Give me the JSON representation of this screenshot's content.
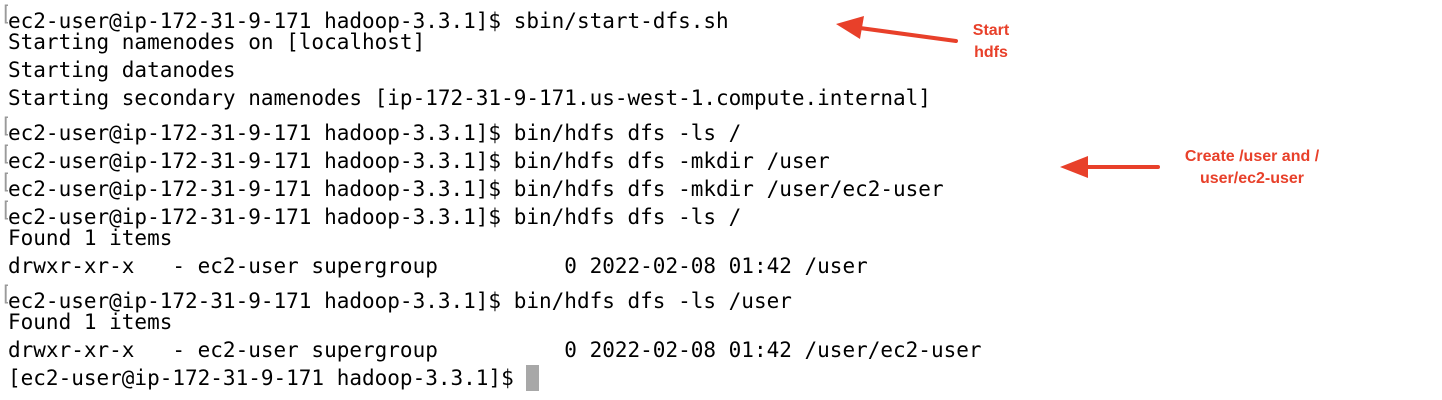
{
  "terminal": {
    "lines": [
      {
        "prefix": "[",
        "text": "ec2-user@ip-172-31-9-171 hadoop-3.3.1]$ sbin/start-dfs.sh"
      },
      {
        "prefix": "",
        "text": "Starting namenodes on [localhost]"
      },
      {
        "prefix": "",
        "text": "Starting datanodes"
      },
      {
        "prefix": "",
        "text": "Starting secondary namenodes [ip-172-31-9-171.us-west-1.compute.internal]"
      },
      {
        "prefix": "[",
        "text": "ec2-user@ip-172-31-9-171 hadoop-3.3.1]$ bin/hdfs dfs -ls /"
      },
      {
        "prefix": "[",
        "text": "ec2-user@ip-172-31-9-171 hadoop-3.3.1]$ bin/hdfs dfs -mkdir /user"
      },
      {
        "prefix": "[",
        "text": "ec2-user@ip-172-31-9-171 hadoop-3.3.1]$ bin/hdfs dfs -mkdir /user/ec2-user"
      },
      {
        "prefix": "[",
        "text": "ec2-user@ip-172-31-9-171 hadoop-3.3.1]$ bin/hdfs dfs -ls /"
      },
      {
        "prefix": "",
        "text": "Found 1 items"
      },
      {
        "prefix": "",
        "text": "drwxr-xr-x   - ec2-user supergroup          0 2022-02-08 01:42 /user"
      },
      {
        "prefix": "[",
        "text": "ec2-user@ip-172-31-9-171 hadoop-3.3.1]$ bin/hdfs dfs -ls /user"
      },
      {
        "prefix": "",
        "text": "Found 1 items"
      },
      {
        "prefix": "",
        "text": "drwxr-xr-x   - ec2-user supergroup          0 2022-02-08 01:42 /user/ec2-user"
      },
      {
        "prefix": "",
        "text": "[ec2-user@ip-172-31-9-171 hadoop-3.3.1]$ "
      }
    ]
  },
  "annotations": {
    "start_hdfs": {
      "line1": "Start",
      "line2": "hdfs"
    },
    "create_user": {
      "line1": "Create /user and /",
      "line2": "user/ec2-user"
    }
  },
  "colors": {
    "annotation": "#e8402a",
    "text": "#000000",
    "cursor": "#a8a8a8"
  }
}
